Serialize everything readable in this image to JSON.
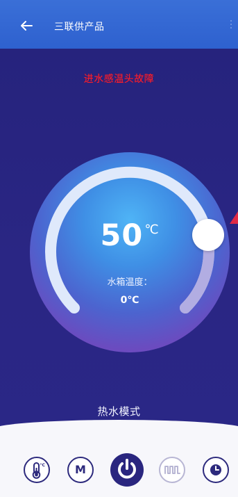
{
  "app": {
    "back_icon": "arrow-left-icon",
    "title": "三联供产品",
    "menu_icon": "more-vertical-icon"
  },
  "alert": {
    "fault_text": "进水感温头故障",
    "color": "#ff1f2a"
  },
  "dial": {
    "set_temperature": "50",
    "unit": "℃",
    "tank_label": "水箱温度：",
    "tank_value": "0℃",
    "progress_fraction": 0.75
  },
  "mode": {
    "label": "热水模式"
  },
  "toolbar": {
    "items": [
      {
        "name": "thermometer-button",
        "icon": "thermometer-icon",
        "state": "normal"
      },
      {
        "name": "mode-m-button",
        "label": "M",
        "icon": "m-letter-icon",
        "state": "normal"
      },
      {
        "name": "power-button",
        "icon": "power-icon",
        "state": "active"
      },
      {
        "name": "wave-button",
        "icon": "wave-icon",
        "state": "faded"
      },
      {
        "name": "clock-button",
        "icon": "clock-icon",
        "state": "normal"
      }
    ]
  },
  "colors": {
    "app_bar": "#3a6fd7",
    "background": "#26237a",
    "accent": "#2a267f",
    "dial_inner": "#4fb4f6",
    "dial_outer": "#8e56c9",
    "bottom_bg": "#f7f7fb"
  }
}
